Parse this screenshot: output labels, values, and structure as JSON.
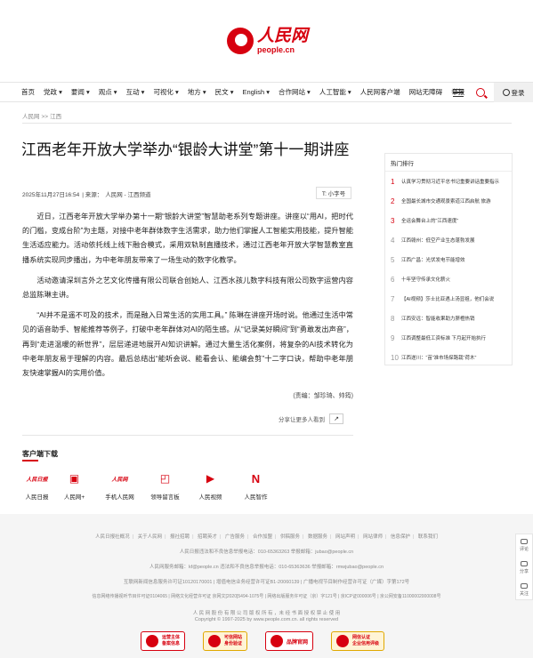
{
  "logo": {
    "cn": "人民网",
    "en": "people.cn"
  },
  "nav": {
    "items": [
      "首页",
      "党政 ▾",
      "要闻 ▾",
      "观点 ▾",
      "互动 ▾",
      "可视化 ▾",
      "地方 ▾",
      "民文 ▾",
      "English ▾",
      "合作网站 ▾",
      "人工智能 ▾",
      "人民网客户端",
      "网站无障碍",
      "举报"
    ],
    "login": "登录"
  },
  "breadcrumb": {
    "home": "人民网",
    "sep": ">>",
    "section": "江西"
  },
  "article": {
    "title": "江西老年开放大学举办“银龄大讲堂”第十一期讲座",
    "date": "2025年11月27日16:54",
    "source_prefix": "| 来源：",
    "source": "人民网 - 江西频道",
    "font_size_label": "T: 小字号",
    "paragraphs": [
      "近日，江西老年开放大学举办第十一期“银龄大讲堂”智慧助老系列专题讲座。讲座以“用AI，把时代的门槛，变成台阶”为主题，对接中老年群体数字生活需求，助力他们掌握人工智能实用技能，提升智能生活适应能力。活动依托线上线下融合模式，采用双轨制直播技术，通过江西老年开放大学智慧教室直播系统实现同步播出，为中老年朋友带来了一场生动的数字化教学。",
      "活动邀请深圳言外之艺文化传播有限公司联合创始人、江西水孩儿数字科技有限公司数字运营内容总监陈琳主讲。",
      "“AI并不是遥不可及的技术，而是融入日常生活的实用工具。” 陈琳在讲座开场时说。他通过生活中常见的语音助手、智能推荐等例子，打破中老年群体对AI的陌生感。从“记录美好瞬间”到“勇敢发出声音”，再到“走进温暖的新世界”，层层递进地展开AI知识讲解。通过大量生活化案例，将复杂的AI技术转化为中老年朋友易于理解的内容。最后总结出“能听会说、能看会认、能编会剪”十二字口诀，帮助中老年朋友快速掌握AI的实用价值。"
    ],
    "editor": "(责编：邹珍琦、帅筠)",
    "share_label": "分享让更多人看到"
  },
  "hot": {
    "title": "热门排行",
    "items": [
      "认真学习贯彻习近平总书记重要讲话重要指示",
      "全国最长城市交通观景索道江西启航 旅游",
      "全运会舞台上的“江西速度”",
      "江西赣州：低空产业生态蓬勃发展",
      "江西广昌：光伏发电节能增效",
      "十年坚守传承文化薪火",
      "【AI视频】莎士比亚遇上汤显祖，他们会说",
      "江西安远：智能收果助力脐橙热销",
      "江西调整最低工资标准 下月起开始执行",
      "江西遂川：“苗”准市场探路栽“荷木”"
    ]
  },
  "client": {
    "title": "客户端下载",
    "apps": [
      {
        "label": "人民日报",
        "icon": "people-daily-icon",
        "glyph": "人民日报"
      },
      {
        "label": "人民网+",
        "icon": "people-plus-icon",
        "glyph": "▣"
      },
      {
        "label": "手机人民网",
        "icon": "mobile-people-icon",
        "glyph": "人民网"
      },
      {
        "label": "领导留言板",
        "icon": "message-board-icon",
        "glyph": "◰"
      },
      {
        "label": "人民视频",
        "icon": "video-play-icon",
        "glyph": "▶"
      },
      {
        "label": "人民智作",
        "icon": "zhizuo-icon",
        "glyph": "N"
      }
    ]
  },
  "footer": {
    "links": [
      "人民日报社概况",
      "关于人民网",
      "报社招聘",
      "招聘英才",
      "广告服务",
      "合作加盟",
      "供稿服务",
      "数据服务",
      "网站声明",
      "网站律师",
      "信息保护",
      "联系我们"
    ],
    "line2": "人民日报违法和不良信息举报电话：010-65363263    举报邮箱：jubao@people.cn",
    "line3": "人民网服务邮箱：kf@people.cn    违法和不良信息举报电话：010-65363636    举报邮箱：rmwjubao@people.cn",
    "line4": "互联网新闻信息服务许可证10120170001 | 增值电信业务经营许可证B1-20060139 | 广播电视节目制作经营许可证（广媒）字第172号",
    "line5": "信息网络传播视听节目许可证0104065 | 网络文化经营许可证 京网文[2020]5494-1075号 | 网络出版服务许可证（京）字121号 | 京ICP证000006号 | 京公网安备11000002000008号",
    "copyright_cn": "人 民 网 股 份 有 限 公 司 版 权 所 有 ，未 经 书 面 授 权 禁 止 使 用",
    "copyright_en": "Copyright © 1997-2025 by www.people.com.cn. all rights reserved",
    "badges": [
      "运营主体\n备案信息",
      "可信网站\n身份验证",
      "品牌官网",
      "网信认证\n企业信用评级"
    ]
  },
  "side": {
    "items": [
      "评论",
      "分享",
      "关注"
    ]
  }
}
